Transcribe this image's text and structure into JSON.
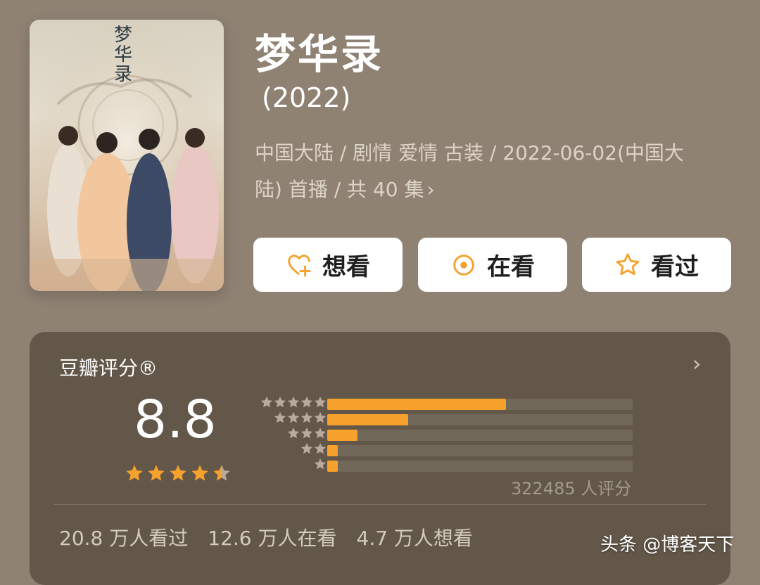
{
  "movie": {
    "poster_text": "梦华录",
    "title": "梦华录",
    "year": "(2022)",
    "meta_line1": "中国大陆 / 剧情 爱情 古装 / 2022-06-02(中国大",
    "meta_line2": "陆) 首播 / 共 40 集",
    "meta_chevron": "›"
  },
  "actions": {
    "want_label": "想看",
    "watching_label": "在看",
    "watched_label": "看过"
  },
  "rating": {
    "title": "豆瓣评分®",
    "chevron": "›",
    "score": "8.8",
    "score_stars": 4.5,
    "distribution": [
      {
        "stars": 5,
        "fraction": 0.586
      },
      {
        "stars": 4,
        "fraction": 0.265
      },
      {
        "stars": 3,
        "fraction": 0.1
      },
      {
        "stars": 2,
        "fraction": 0.035
      },
      {
        "stars": 1,
        "fraction": 0.035
      }
    ],
    "count_text": "322485 人评分",
    "stats": [
      "20.8 万人看过",
      "12.6 万人在看",
      "4.7 万人想看"
    ]
  },
  "watermark": "头条 @博客天下",
  "colors": {
    "background": "#8f8273",
    "panel": "#625748",
    "accent": "#f5a12c",
    "button_bg": "#ffffff"
  },
  "icons": {
    "want": "heart-plus-icon",
    "watching": "target-circle-icon",
    "watched": "star-outline-icon"
  }
}
